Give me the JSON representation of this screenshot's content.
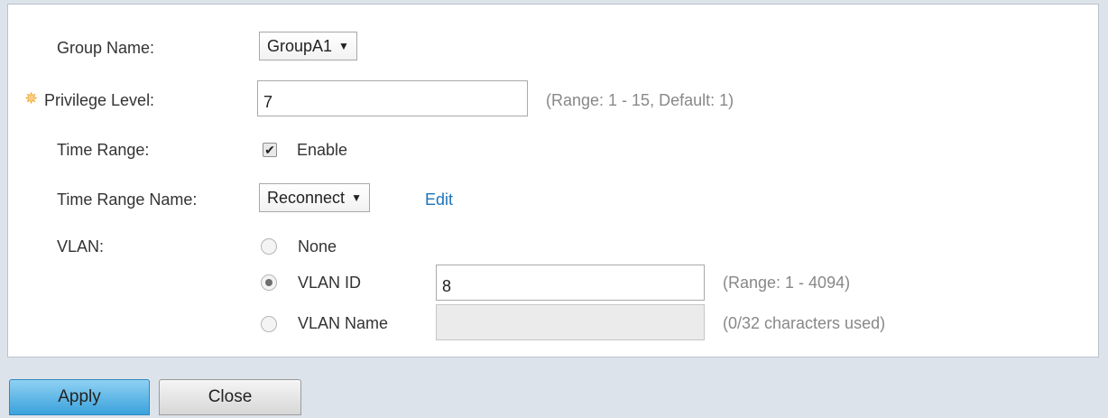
{
  "form": {
    "group_name": {
      "label": "Group Name:",
      "value": "GroupA1"
    },
    "privilege_level": {
      "label": "Privilege Level:",
      "value": "7",
      "hint": "(Range: 1 - 15, Default: 1)",
      "required_icon": "gear-star-icon"
    },
    "time_range": {
      "label": "Time Range:",
      "checkbox_label": "Enable",
      "checked": true
    },
    "time_range_name": {
      "label": "Time Range Name:",
      "value": "Reconnect",
      "edit_link": "Edit"
    },
    "vlan": {
      "label": "VLAN:",
      "options": [
        {
          "label": "None",
          "checked": false
        },
        {
          "label": "VLAN ID",
          "checked": true,
          "value": "8",
          "hint": "(Range: 1 - 4094)"
        },
        {
          "label": "VLAN Name",
          "checked": false,
          "value": "",
          "hint": "(0/32 characters used)"
        }
      ]
    }
  },
  "buttons": {
    "apply": "Apply",
    "close": "Close"
  },
  "colors": {
    "accent": "#1b75bb",
    "required": "#f0a01a",
    "apply_button": "#3aa2dc"
  }
}
